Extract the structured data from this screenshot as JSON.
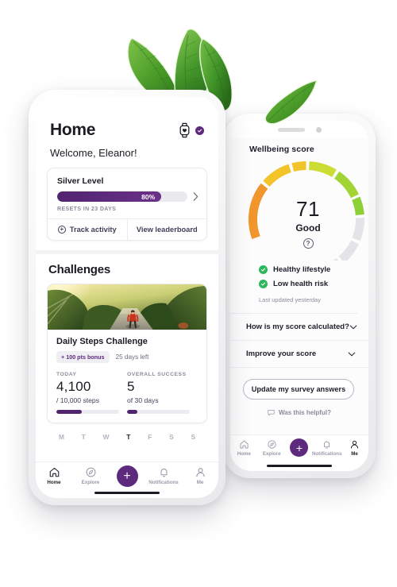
{
  "left_phone": {
    "header": {
      "title": "Home",
      "watch_icon": "smartwatch-heart-icon",
      "verified_icon": "verified-check-icon"
    },
    "welcome": "Welcome, Eleanor!",
    "level_card": {
      "level_name": "Silver Level",
      "progress_label": "80%",
      "progress_value": 80,
      "resets": "RESETS IN 23 DAYS",
      "chevron_icon": "chevron-right-icon",
      "actions": [
        {
          "label": "Track activity",
          "icon": "plus-circle-icon"
        },
        {
          "label": "View leaderboard",
          "icon": ""
        }
      ]
    },
    "challenges": {
      "section_title": "Challenges",
      "card": {
        "image_alt": "runner-on-forest-path-photo",
        "name": "Daily Steps Challenge",
        "bonus_pill": "+ 100 pts bonus",
        "days_left": "25 days left",
        "stats": [
          {
            "key": "TODAY",
            "value": "4,100",
            "sub": "/ 10,000 steps",
            "progress": 41
          },
          {
            "key": "OVERALL SUCCESS",
            "value": "5",
            "sub": "of 30 days",
            "progress": 17
          }
        ]
      }
    },
    "weekdays": [
      {
        "letter": "M",
        "active": false
      },
      {
        "letter": "T",
        "active": false
      },
      {
        "letter": "W",
        "active": false
      },
      {
        "letter": "T",
        "active": true
      },
      {
        "letter": "F",
        "active": false
      },
      {
        "letter": "S",
        "active": false
      },
      {
        "letter": "S",
        "active": false
      }
    ],
    "navbar": [
      {
        "label": "Home",
        "icon": "home-icon",
        "active": true
      },
      {
        "label": "Explore",
        "icon": "compass-icon",
        "active": false
      },
      {
        "label": "",
        "icon": "plus-fab-icon",
        "active": false
      },
      {
        "label": "Notifications",
        "icon": "bell-icon",
        "active": false
      },
      {
        "label": "Me",
        "icon": "person-icon",
        "active": false
      }
    ]
  },
  "right_phone": {
    "title": "Wellbeing score",
    "gauge": {
      "score": "71",
      "rating": "Good",
      "help_icon": "question-mark-icon",
      "value": 71,
      "max": 100,
      "segment_colors": [
        "#f0962d",
        "#f3c42a",
        "#e9d92c",
        "#c3dc35",
        "#8ed038",
        "#e4e4e8",
        "#e4e4e8"
      ]
    },
    "checks": [
      {
        "label": "Healthy lifestyle",
        "icon": "green-check-icon"
      },
      {
        "label": "Low health risk",
        "icon": "green-check-icon"
      }
    ],
    "last_updated": "Last updated yesterday",
    "accordions": [
      {
        "label": "How is my score calculated?",
        "icon": "chevron-down-icon"
      },
      {
        "label": "Improve your score",
        "icon": "chevron-down-icon"
      }
    ],
    "cta": "Update my survey answers",
    "helpful": {
      "label": "Was this helpful?",
      "icon": "speech-bubble-icon"
    },
    "navbar": [
      {
        "label": "Home",
        "icon": "home-icon",
        "active": false
      },
      {
        "label": "Explore",
        "icon": "compass-icon",
        "active": false
      },
      {
        "label": "",
        "icon": "plus-fab-icon",
        "active": false
      },
      {
        "label": "Notifications",
        "icon": "bell-icon",
        "active": false
      },
      {
        "label": "Me",
        "icon": "person-icon",
        "active": true
      }
    ]
  },
  "decoration": {
    "leaves": "green-leaves-decoration"
  },
  "colors": {
    "brand_purple": "#5e2a7e",
    "deep_purple": "#512470",
    "text_dark": "#1b1b24",
    "text_muted": "#8b8b9c",
    "green": "#2eb85c",
    "leaf_green": "#4d9e2a"
  }
}
